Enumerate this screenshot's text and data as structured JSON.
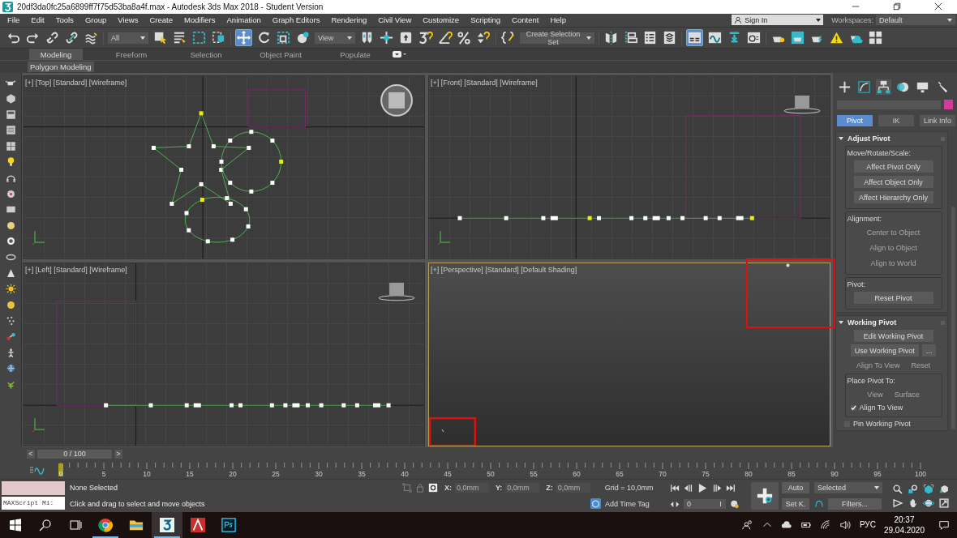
{
  "window": {
    "title": "20df3da0fc25a6899ff7f75d53ba8a4f.max - Autodesk 3ds Max 2018 - Student Version"
  },
  "menu": [
    "File",
    "Edit",
    "Tools",
    "Group",
    "Views",
    "Create",
    "Modifiers",
    "Animation",
    "Graph Editors",
    "Rendering",
    "Civil View",
    "Customize",
    "Scripting",
    "Content",
    "Help"
  ],
  "account": {
    "sign_in": "Sign In",
    "workspaces_label": "Workspaces:",
    "workspace": "Default"
  },
  "toolbar": {
    "selection_filter": "All",
    "reference_coordinate_system": "View",
    "named_selection_set": "Create Selection Set"
  },
  "ribbon": {
    "tabs": [
      {
        "label": "Modeling",
        "selected": true
      },
      {
        "label": "Freeform",
        "selected": false
      },
      {
        "label": "Selection",
        "selected": false
      },
      {
        "label": "Object Paint",
        "selected": false
      },
      {
        "label": "Populate",
        "selected": false
      }
    ],
    "panel": "Polygon Modeling"
  },
  "viewports": [
    {
      "kind": "top",
      "label": "[+] [Top] [Standard] [Wireframe]",
      "active": false
    },
    {
      "kind": "front",
      "label": "[+] [Front] [Standard] [Wireframe]",
      "active": false
    },
    {
      "kind": "left",
      "label": "[+] [Left] [Standard] [Wireframe]",
      "active": false
    },
    {
      "kind": "perspective",
      "label": "[+] [Perspective] [Standard] [Default Shading]",
      "active": true
    }
  ],
  "command_panel": {
    "subtabs": [
      {
        "label": "Pivot",
        "selected": true
      },
      {
        "label": "IK",
        "selected": false
      },
      {
        "label": "Link Info",
        "selected": false
      }
    ],
    "rollouts": [
      {
        "title": "Adjust Pivot",
        "expanded": true,
        "items": [
          {
            "kind": "group",
            "title": "Move/Rotate/Scale:",
            "items": [
              {
                "kind": "button",
                "label": "Affect Pivot Only",
                "disabled": false
              },
              {
                "kind": "button",
                "label": "Affect Object Only",
                "disabled": false
              },
              {
                "kind": "button",
                "label": "Affect Hierarchy Only",
                "disabled": false
              }
            ]
          },
          {
            "kind": "group",
            "title": "Alignment:",
            "items": [
              {
                "kind": "button",
                "label": "Center to Object",
                "disabled": true
              },
              {
                "kind": "button",
                "label": "Align to Object",
                "disabled": true
              },
              {
                "kind": "button",
                "label": "Align to World",
                "disabled": true
              }
            ]
          },
          {
            "kind": "group",
            "title": "Pivot:",
            "items": [
              {
                "kind": "button",
                "label": "Reset Pivot",
                "disabled": false
              }
            ]
          }
        ]
      },
      {
        "title": "Working Pivot",
        "expanded": true,
        "items": [
          {
            "kind": "button",
            "label": "Edit Working Pivot",
            "disabled": false
          },
          {
            "kind": "row",
            "items": [
              {
                "kind": "button",
                "label": "Use Working Pivot",
                "disabled": false
              },
              {
                "kind": "button",
                "label": "...",
                "disabled": false
              }
            ]
          },
          {
            "kind": "row",
            "items": [
              {
                "kind": "button",
                "label": "Align To View",
                "disabled": true
              },
              {
                "kind": "button",
                "label": "Reset",
                "disabled": true
              }
            ]
          },
          {
            "kind": "group",
            "title": "Place Pivot To:",
            "items": [
              {
                "kind": "row",
                "items": [
                  {
                    "kind": "button",
                    "label": "View",
                    "disabled": true
                  },
                  {
                    "kind": "button",
                    "label": "Surface",
                    "disabled": true
                  }
                ]
              },
              {
                "kind": "checkbox",
                "label": "Align To View",
                "checked": true
              }
            ]
          },
          {
            "kind": "checkbox",
            "label": "Pin Working Pivot",
            "checked": false
          }
        ]
      }
    ]
  },
  "time_slider": {
    "level": 0,
    "prev": "<",
    "position": "0 / 100",
    "next": ">"
  },
  "track_bar": {
    "current": "0",
    "labels": [
      "5",
      "10",
      "15",
      "20",
      "25",
      "30",
      "35",
      "40",
      "45",
      "50",
      "55",
      "60",
      "65",
      "70",
      "75",
      "80",
      "85",
      "90",
      "95",
      "100"
    ]
  },
  "status": {
    "selection": "None Selected",
    "prompt": "Click and drag to select and move objects",
    "listener": "MAXScript Mi:",
    "x_label": "X:",
    "x": "0,0mm",
    "y_label": "Y:",
    "y": "0,0mm",
    "z_label": "Z:",
    "z": "0,0mm",
    "grid": "Grid = 10,0mm",
    "time_tag": "Add Time Tag"
  },
  "animation": {
    "frame": "0",
    "auto": "Auto",
    "set_key": "Set K.",
    "key_filter": "Selected",
    "filters": "Filters..."
  },
  "taskbar": {
    "apps": [
      {
        "kind": "chrome",
        "running": true,
        "selected": false
      },
      {
        "kind": "explorer",
        "running": false,
        "selected": false
      },
      {
        "kind": "max",
        "running": true,
        "selected": true
      },
      {
        "kind": "autocad",
        "running": false,
        "selected": false
      },
      {
        "kind": "photoshop",
        "running": false,
        "selected": false
      }
    ],
    "language": "РУС",
    "time": "20:37",
    "date": "29.04.2020"
  }
}
